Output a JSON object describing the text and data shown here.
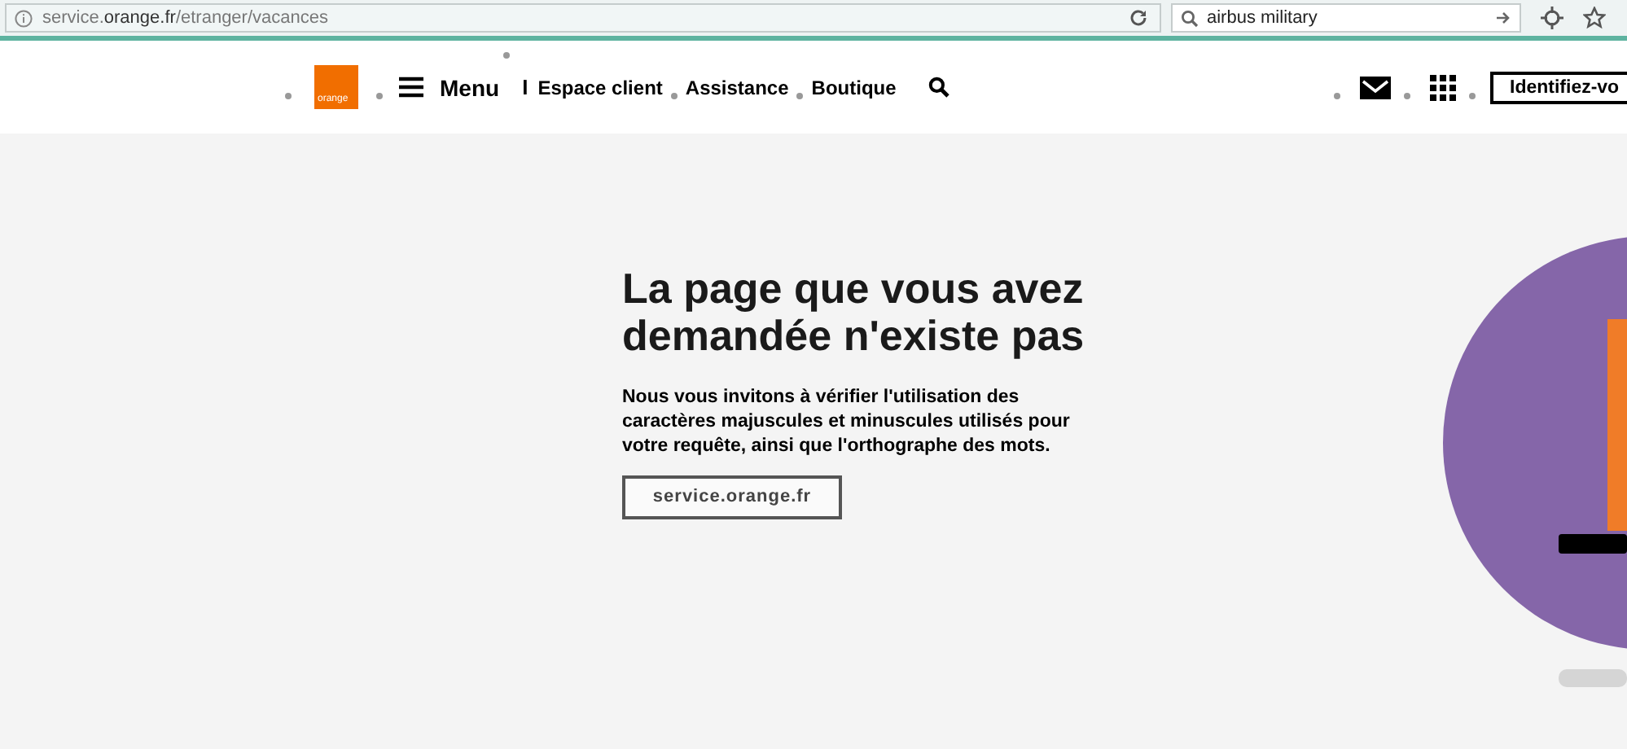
{
  "browser": {
    "url": "service.**orange.fr**/etranger/vacances",
    "search": "airbus military"
  },
  "header": {
    "logo": "orange",
    "menu": "Menu",
    "separator": "I",
    "nav": [
      {
        "label": "Espace client"
      },
      {
        "label": "Assistance"
      },
      {
        "label": "Boutique"
      }
    ],
    "login": "Identifiez-vo"
  },
  "main": {
    "title": "La page que vous avez demandée n'existe pas",
    "message": "Nous vous invitons à vérifier l'utilisation des caractères majuscules et minuscules utilisés pour votre requête, ainsi que l'orthographe des mots.",
    "link": "service.orange.fr"
  }
}
